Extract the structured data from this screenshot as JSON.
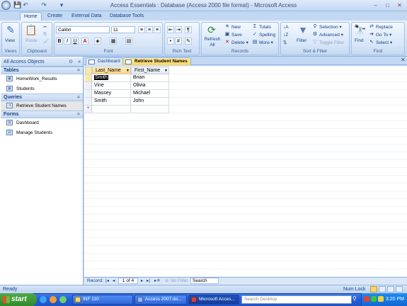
{
  "window": {
    "title": "Access Essentials : Database (Access 2000 file format) - Microsoft Access",
    "controls": {
      "minimize": "–",
      "maximize": "□",
      "close": "✕"
    }
  },
  "qat": {
    "save_icon": "💾",
    "undo_icon": "↶",
    "redo_icon": "↷",
    "more_icon": "▾"
  },
  "ribbon_tabs": [
    "Home",
    "Create",
    "External Data",
    "Database Tools"
  ],
  "ribbon": {
    "views": {
      "label": "Views",
      "view_button": "View"
    },
    "clipboard": {
      "label": "Clipboard",
      "paste_button": "Paste"
    },
    "font": {
      "label": "Font",
      "font_name": "Calibri",
      "font_size": "11",
      "bold": "B",
      "italic": "I",
      "underline": "U",
      "font_color": "A"
    },
    "rich_text": {
      "label": "Rich Text"
    },
    "records": {
      "label": "Records",
      "refresh_all": "Refresh All",
      "new": "New",
      "save": "Save",
      "delete": "Delete",
      "totals": "Totals",
      "spelling": "Spelling",
      "more": "More"
    },
    "sort_filter": {
      "label": "Sort & Filter",
      "filter": "Filter",
      "selection": "Selection",
      "advanced": "Advanced",
      "toggle_filter": "Toggle Filter"
    },
    "find": {
      "label": "Find",
      "find": "Find",
      "replace": "Replace",
      "go_to": "Go To",
      "select": "Select"
    }
  },
  "nav_pane": {
    "header": "All Access Objects",
    "groups": [
      {
        "name": "Tables",
        "items": [
          "HomeWork_Results",
          "Students"
        ]
      },
      {
        "name": "Queries",
        "items": [
          "Retrieve Student Names"
        ]
      },
      {
        "name": "Forms",
        "items": [
          "Dashboard",
          "Manage Students"
        ]
      }
    ]
  },
  "doc_tabs": [
    "Dashboard",
    "Retrieve Student Names"
  ],
  "datasheet": {
    "columns": [
      "Last_Name",
      "First_Name"
    ],
    "rows": [
      [
        "Smith",
        "Brian"
      ],
      [
        "Vine",
        "Olivia"
      ],
      [
        "Massey",
        "Michael"
      ],
      [
        "Smith",
        "John"
      ]
    ],
    "new_row_marker": "*"
  },
  "record_nav": {
    "label": "Record:",
    "position": "1 of 4",
    "filter_status": "No Filter",
    "search": "Search"
  },
  "status": {
    "left": "Ready",
    "num_lock": "Num Lock"
  },
  "taskbar": {
    "start": "start",
    "tasks": [
      "INF 110",
      "Access 2007.do...",
      "Microsoft Acces..."
    ],
    "search_placeholder": "Search Desktop",
    "clock": "3:20 PM"
  },
  "colors": {
    "accent": "#15428b",
    "ribbon_bg": "#cfe0f6",
    "active_tab": "#ffd55a",
    "selection": "#000000"
  }
}
